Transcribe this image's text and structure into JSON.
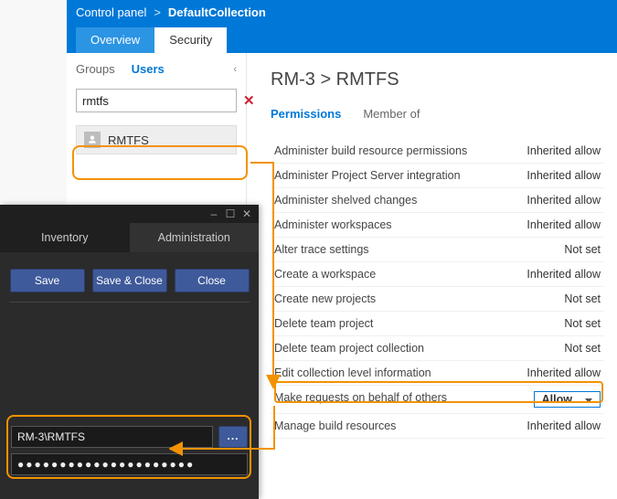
{
  "tfs": {
    "breadcrumb": {
      "root": "Control panel",
      "sep": ">",
      "current": "DefaultCollection"
    },
    "topTabs": {
      "overview": "Overview",
      "security": "Security"
    },
    "left": {
      "subtabs": {
        "groups": "Groups",
        "users": "Users"
      },
      "search": {
        "value": "rmtfs",
        "clear": "✕"
      },
      "result": {
        "name": "RMTFS"
      }
    },
    "right": {
      "title": "RM-3 > RMTFS",
      "tabs": {
        "permissions": "Permissions",
        "memberof": "Member of"
      },
      "perms": [
        {
          "label": "Administer build resource permissions",
          "value": "Inherited allow"
        },
        {
          "label": "Administer Project Server integration",
          "value": "Inherited allow"
        },
        {
          "label": "Administer shelved changes",
          "value": "Inherited allow"
        },
        {
          "label": "Administer workspaces",
          "value": "Inherited allow"
        },
        {
          "label": "Alter trace settings",
          "value": "Not set"
        },
        {
          "label": "Create a workspace",
          "value": "Inherited allow"
        },
        {
          "label": "Create new projects",
          "value": "Not set"
        },
        {
          "label": "Delete team project",
          "value": "Not set"
        },
        {
          "label": "Delete team project collection",
          "value": "Not set"
        },
        {
          "label": "Edit collection level information",
          "value": "Inherited allow"
        },
        {
          "label": "Make requests on behalf of others",
          "value": "Allow",
          "boxed": true
        },
        {
          "label": "Manage build resources",
          "value": "Inherited allow"
        }
      ]
    }
  },
  "dark": {
    "win": {
      "min": "–",
      "max": "☐",
      "close": "✕"
    },
    "tabs": {
      "inventory": "Inventory",
      "administration": "Administration"
    },
    "buttons": {
      "save": "Save",
      "saveclose": "Save & Close",
      "close": "Close"
    },
    "cred": {
      "user": "RM-3\\RMTFS",
      "pass": "●●●●●●●●●●●●●●●●●●●●●",
      "browse": "..."
    }
  }
}
